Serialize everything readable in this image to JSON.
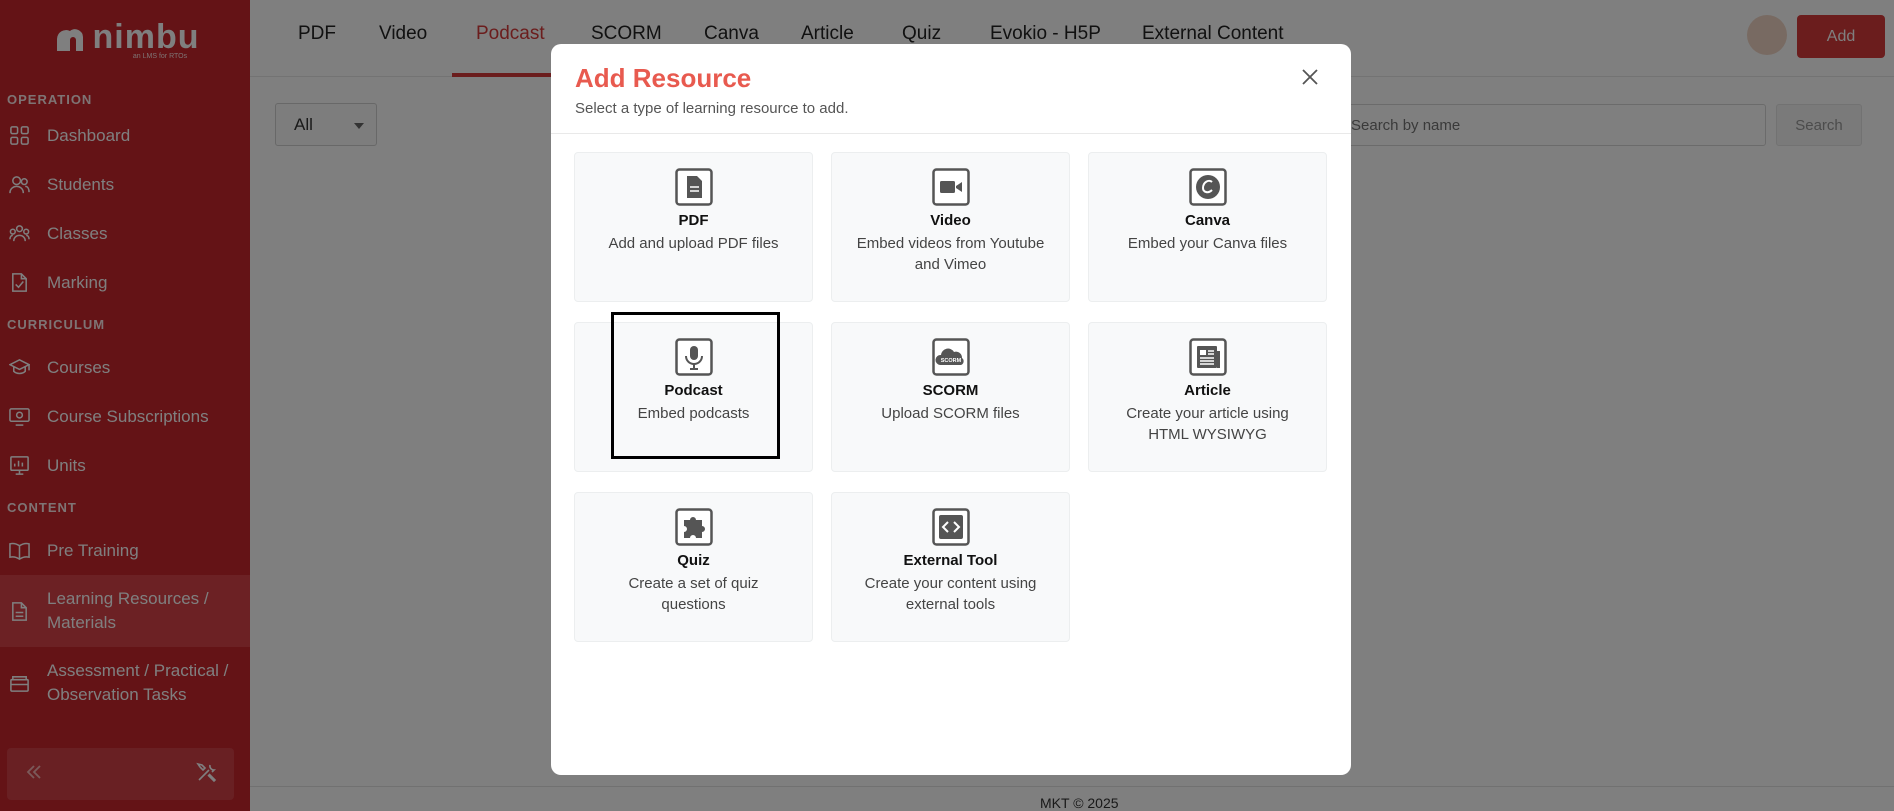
{
  "sidebar": {
    "logo_text": "nimbu",
    "logo_tagline": "an LMS for RTOs",
    "sections": [
      {
        "label": "OPERATION",
        "items": [
          {
            "label": "Dashboard",
            "icon": "grid-icon"
          },
          {
            "label": "Students",
            "icon": "users-icon"
          },
          {
            "label": "Classes",
            "icon": "group-icon"
          },
          {
            "label": "Marking",
            "icon": "doc-check-icon"
          }
        ]
      },
      {
        "label": "CURRICULUM",
        "items": [
          {
            "label": "Courses",
            "icon": "graduation-cap-icon"
          },
          {
            "label": "Course Subscriptions",
            "icon": "monitor-icon"
          },
          {
            "label": "Units",
            "icon": "chart-board-icon"
          }
        ]
      },
      {
        "label": "CONTENT",
        "items": [
          {
            "label": "Pre Training",
            "icon": "book-icon"
          },
          {
            "label": "Learning Resources / Materials",
            "icon": "file-icon",
            "active": true
          },
          {
            "label": "Assessment / Practical / Observation Tasks",
            "icon": "archive-icon"
          }
        ]
      }
    ]
  },
  "topbar": {
    "tabs": [
      "PDF",
      "Video",
      "Podcast",
      "SCORM",
      "Canva",
      "Article",
      "Quiz",
      "Evokio - H5P",
      "External Content"
    ],
    "active_tab": "Podcast",
    "add_label": "Add"
  },
  "content": {
    "filter_value": "All",
    "search_placeholder": "Search by name",
    "search_label": "Search",
    "footer": "MKT © 2025"
  },
  "modal": {
    "title": "Add Resource",
    "subtitle": "Select a type of learning resource to add.",
    "cards": [
      {
        "title": "PDF",
        "desc": "Add and upload PDF files",
        "icon": "pdf-file-icon"
      },
      {
        "title": "Video",
        "desc": "Embed videos from Youtube and Vimeo",
        "icon": "video-camera-icon"
      },
      {
        "title": "Canva",
        "desc": "Embed your Canva files",
        "icon": "canva-icon"
      },
      {
        "title": "Podcast",
        "desc": "Embed podcasts",
        "icon": "microphone-icon",
        "selected": true
      },
      {
        "title": "SCORM",
        "desc": "Upload SCORM files",
        "icon": "scorm-cloud-icon",
        "badge": "SCORM"
      },
      {
        "title": "Article",
        "desc": "Create your article using HTML WYSIWYG",
        "icon": "newspaper-icon"
      },
      {
        "title": "Quiz",
        "desc": "Create a set of quiz questions",
        "icon": "puzzle-icon"
      },
      {
        "title": "External Tool",
        "desc": "Create your content using external tools",
        "icon": "code-icon"
      }
    ]
  },
  "colors": {
    "brand": "#c9262d",
    "accent": "#e85a4f"
  }
}
